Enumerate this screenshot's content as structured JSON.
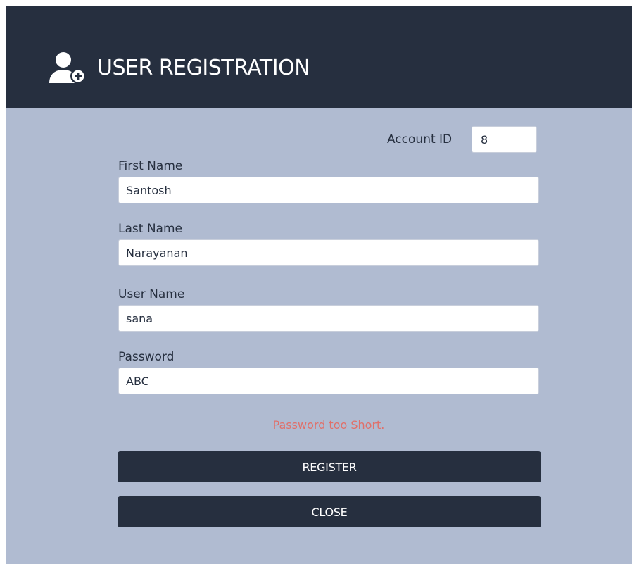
{
  "window": {
    "title": "USER REGISTRATION",
    "icon": "add-user-icon"
  },
  "form": {
    "account_id": {
      "label": "Account ID",
      "value": "8"
    },
    "first_name": {
      "label": "First Name",
      "value": "Santosh"
    },
    "last_name": {
      "label": "Last Name",
      "value": "Narayanan"
    },
    "user_name": {
      "label": "User Name",
      "value": "sana"
    },
    "password": {
      "label": "Password",
      "value": "ABC"
    },
    "error_message": "Password too Short."
  },
  "buttons": {
    "register_label": "REGISTER",
    "close_label": "CLOSE"
  },
  "colors": {
    "header_bg": "#262f3f",
    "body_bg": "#b0bbd1",
    "error_text": "#e0706a",
    "button_bg": "#262f3f"
  }
}
